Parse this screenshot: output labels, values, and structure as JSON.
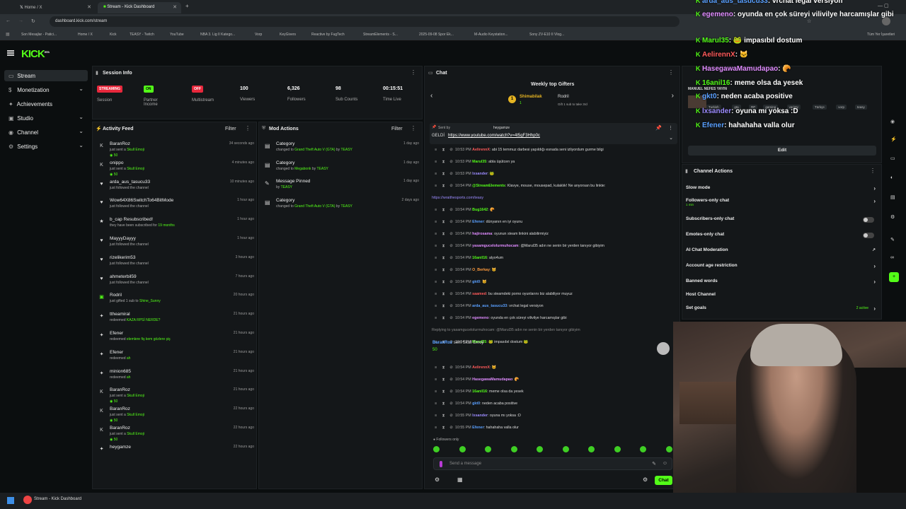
{
  "browser": {
    "tabs": [
      {
        "label": "Home / X"
      },
      {
        "label": "Stream - Kick Dashboard"
      }
    ],
    "url": "dashboard.kick.com/stream",
    "bookmarks": [
      "Son Mesajlar - Patici...",
      "Home / X",
      "Kick",
      "TEASY - Twitch",
      "YouTube",
      "NBA 3. Lig II Katego...",
      "Vorp",
      "KeyGivers",
      "Reactive by FugTech",
      "StreamElements - S...",
      "2025-09-08 Spor Ek...",
      "M-Audio Keystation...",
      "Sony ZV-E10 II Vlog..."
    ],
    "other_bookmarks": "Tüm Yer İşaretleri"
  },
  "header": {
    "logo": "KICK",
    "logo_sup": "BETA"
  },
  "sidebar": {
    "items": [
      {
        "label": "Stream",
        "icon": "▭"
      },
      {
        "label": "Monetization",
        "icon": "$"
      },
      {
        "label": "Achievements",
        "icon": "✦"
      },
      {
        "label": "Studio",
        "icon": "▣"
      },
      {
        "label": "Channel",
        "icon": "◉"
      },
      {
        "label": "Settings",
        "icon": "⚙"
      }
    ]
  },
  "session": {
    "title": "Session Info",
    "stats": [
      {
        "value": "STREAMING",
        "label": "Session",
        "badge_color": "#e8283c"
      },
      {
        "value": "ON",
        "label": "Partner Income",
        "badge_color": "#53fc18"
      },
      {
        "value": "OFF",
        "label": "Multistream",
        "badge_color": "#e8283c"
      },
      {
        "value": "100",
        "label": "Viewers"
      },
      {
        "value": "6,326",
        "label": "Followers"
      },
      {
        "value": "98",
        "label": "Sub Counts"
      },
      {
        "value": "00:15:51",
        "label": "Time Live"
      }
    ]
  },
  "activity_feed": {
    "title": "Activity Feed",
    "filter": "Filter",
    "items": [
      {
        "user": "BaranRoz",
        "desc": "just sent a",
        "hl": "Skull Emoji",
        "time": "34 seconds ago",
        "kicks": "50",
        "icon": "kick"
      },
      {
        "user": "onippo",
        "desc": "just sent a",
        "hl": "Skull Emoji",
        "time": "4 minutes ago",
        "kicks": "50",
        "icon": "kick"
      },
      {
        "user": "arda_aus_tasucu33",
        "desc": "just followed the channel",
        "hl": "",
        "time": "10 minutes ago",
        "kicks": "",
        "icon": "heart"
      },
      {
        "user": "Wow64X86SwitchTo64BitMode",
        "desc": "just followed the channel",
        "hl": "",
        "time": "1 hour ago",
        "kicks": "",
        "icon": "heart"
      },
      {
        "user": "b_cap Resubscribed!",
        "desc": "they have been subscribed for",
        "hl": "19 months",
        "time": "1 hour ago",
        "kicks": "",
        "icon": "star"
      },
      {
        "user": "MayyyDayyy",
        "desc": "just followed the channel",
        "hl": "",
        "time": "1 hour ago",
        "kicks": "",
        "icon": "heart"
      },
      {
        "user": "rizelikerim53",
        "desc": "just followed the channel",
        "hl": "",
        "time": "3 hours ago",
        "kicks": "",
        "icon": "heart"
      },
      {
        "user": "ahmeterbil59",
        "desc": "just followed the channel",
        "hl": "",
        "time": "7 hours ago",
        "kicks": "",
        "icon": "heart"
      },
      {
        "user": "Rodril",
        "desc": "just gifted 1 sub to",
        "hl": "Shine_Sunny",
        "time": "20 hours ago",
        "kicks": "",
        "icon": "gift"
      },
      {
        "user": "ttheamiral",
        "desc": "redeemed",
        "hl": "KAZA RPSİ NERDE?",
        "time": "21 hours ago",
        "kicks": "",
        "icon": "redeem"
      },
      {
        "user": "Efener",
        "desc": "redeemed",
        "hl": "elemlere fiş kem gözlere şiş",
        "time": "21 hours ago",
        "kicks": "",
        "icon": "redeem"
      },
      {
        "user": "Efener",
        "desc": "redeemed",
        "hl": "ah",
        "time": "21 hours ago",
        "kicks": "",
        "icon": "redeem"
      },
      {
        "user": "minion685",
        "desc": "redeemed",
        "hl": "ah",
        "time": "21 hours ago",
        "kicks": "",
        "icon": "redeem"
      },
      {
        "user": "BaranRoz",
        "desc": "just sent a",
        "hl": "Skull Emoji",
        "time": "21 hours ago",
        "kicks": "50",
        "icon": "kick"
      },
      {
        "user": "BaranRoz",
        "desc": "just sent a",
        "hl": "Skull Emoji",
        "time": "22 hours ago",
        "kicks": "50",
        "icon": "kick"
      },
      {
        "user": "BaranRoz",
        "desc": "just sent a",
        "hl": "Skull Emoji",
        "time": "22 hours ago",
        "kicks": "50",
        "icon": "kick"
      },
      {
        "user": "heygamze",
        "desc": "",
        "hl": "",
        "time": "22 hours ago",
        "kicks": "",
        "icon": "redeem"
      }
    ]
  },
  "mod_actions": {
    "title": "Mod Actions",
    "filter": "Filter",
    "items": [
      {
        "title": "Category",
        "desc": "changed to",
        "hl": "Grand Theft Auto V (GTA)",
        "by": "by",
        "mod": "TEASY",
        "time": "1 day ago",
        "icon": "▤"
      },
      {
        "title": "Category",
        "desc": "changed to",
        "hl": "Megabonk",
        "by": "by",
        "mod": "TEASY",
        "time": "1 day ago",
        "icon": "▤"
      },
      {
        "title": "Message Pinned",
        "desc": "",
        "hl": "",
        "by": "by",
        "mod": "TEASY",
        "time": "1 day ago",
        "icon": "✎"
      },
      {
        "title": "Category",
        "desc": "changed to",
        "hl": "Grand Theft Auto V (GTA)",
        "by": "by",
        "mod": "TEASY",
        "time": "2 days ago",
        "icon": "▤"
      }
    ]
  },
  "chat": {
    "title": "Chat",
    "gifters_title": "Weekly top Gifters",
    "gifter1": "Shimabilak",
    "gifter1_count": "1",
    "gifter2": "Rodril",
    "gifter2_note": "Gift 1 sub to take 3rd",
    "pinned_sender": "Sent by",
    "pinned_user": "heygamze",
    "pinned_text": "GELDİ",
    "pinned_link": "https://www.youtube.com/watch?v=4t5gF3Hhp0c",
    "messages": [
      {
        "time": "10:53 PM",
        "user": "AelirennX",
        "color": "#ff5a5a",
        "text": ": abi 15 temmuz darbesi yapıldığı esnada seni izliyordum gurme bilgi"
      },
      {
        "time": "10:53 PM",
        "user": "Marul35",
        "color": "#53fc18",
        "text": ": abla üşütcen ya"
      },
      {
        "time": "10:53 PM",
        "user": "lxsander",
        "color": "#9d8cff",
        "text": ": 🐸"
      },
      {
        "time": "10:54 PM",
        "user": "@StreamElements",
        "color": "#53fc18",
        "text": ": Klavye, mouse, mousepad, kulaklık! Ne anyorsan bu linkte:"
      },
      {
        "time": "",
        "user": "",
        "color": "#9d8cff",
        "text": "https://wraithesports.com/teasy"
      },
      {
        "time": "10:54 PM",
        "user": "Bug1642",
        "color": "#53fc18",
        "text": ": 🥐"
      },
      {
        "time": "10:54 PM",
        "user": "Efener",
        "color": "#5aa0ff",
        "text": ": dünyanın en iyi oyunu"
      },
      {
        "time": "10:54 PM",
        "user": "hajirosama",
        "color": "#e08cff",
        "text": ": oyunun steam linkini alabilirmiyiz"
      },
      {
        "time": "10:54 PM",
        "user": "yasamgucelolurmuhocam",
        "color": "#e08cff",
        "text": ": @Marul35 adın ne senin bir yerden tanıyor gibiyim"
      },
      {
        "time": "10:54 PM",
        "user": "16anil16",
        "color": "#53fc18",
        "text": ": alyo4um"
      },
      {
        "time": "10:54 PM",
        "user": "O_Berkay",
        "color": "#ff9b3d",
        "text": ": 🐱"
      },
      {
        "time": "10:54 PM",
        "user": "gkt0",
        "color": "#5aa0ff",
        "text": ": 🐱"
      },
      {
        "time": "10:54 PM",
        "user": "saamed",
        "color": "#ff5a5a",
        "text": ": bu steamdeki porno oyunlarını biz alabiliyor muyuz"
      },
      {
        "time": "10:54 PM",
        "user": "arda_aus_tasucu33",
        "color": "#5aa0ff",
        "text": ": vrchat legal versiyon"
      },
      {
        "time": "10:54 PM",
        "user": "egemeno",
        "color": "#e08cff",
        "text": ": oyunda en çok süreyi vilivilye harcamışlar gibi"
      },
      {
        "time": "",
        "user": "",
        "color": "#888",
        "text": "Replying to yasamgucelolurmuhocam: @Marul35 adın ne senin bir yerden tanıyor gibiyim"
      },
      {
        "time": "10:54 PM",
        "user": "Marul35",
        "color": "#53fc18",
        "text": ": 🐸 impasıbıl dostum 🐸"
      }
    ],
    "gift_user": "BaranRoz",
    "gift_text": "sent Skull Emoji",
    "gift_kicks": "50",
    "messages2": [
      {
        "time": "10:54 PM",
        "user": "AelirennX",
        "color": "#ff5a5a",
        "text": ": 🐱"
      },
      {
        "time": "10:54 PM",
        "user": "HasegawaMamudapao",
        "color": "#e08cff",
        "text": ": 🥐"
      },
      {
        "time": "10:54 PM",
        "user": "16anil16",
        "color": "#53fc18",
        "text": ": meme olsa da yesek"
      },
      {
        "time": "10:54 PM",
        "user": "gkt0",
        "color": "#5aa0ff",
        "text": ": neden acaba positive"
      },
      {
        "time": "10:55 PM",
        "user": "lxsander",
        "color": "#9d8cff",
        "text": ": oyuna mı yoksa :D"
      },
      {
        "time": "10:55 PM",
        "user": "Efener",
        "color": "#5aa0ff",
        "text": ": hahahaha valla olur"
      }
    ],
    "followers_only": "Followers only",
    "input_placeholder": "Send a message",
    "send_label": "Chat"
  },
  "overlay_chat": [
    {
      "user": "arda_aus_tasucu33",
      "text": ": vrchat legal versiyon",
      "color": "#5aa0ff"
    },
    {
      "user": "egemeno",
      "text": ": oyunda en çok süreyi vilivilye harcamışlar gibi",
      "color": "#e08cff"
    },
    {
      "user": "Marul35",
      "text": ": 🐸 impasıbıl dostum",
      "color": "#53fc18"
    },
    {
      "user": "AelirennX",
      "text": ": 🐱",
      "color": "#ff5a5a"
    },
    {
      "user": "HasegawaMamudapao",
      "text": ": 🥐",
      "color": "#e08cff"
    },
    {
      "user": "16anil16",
      "text": ": meme olsa da yesek",
      "color": "#53fc18"
    },
    {
      "user": "gkt0",
      "text": ": neden acaba positive",
      "color": "#5aa0ff"
    },
    {
      "user": "lxsander",
      "text": ": oyuna mı yoksa :D",
      "color": "#9d8cff"
    },
    {
      "user": "Efener",
      "text": ": hahahaha valla olur",
      "color": "#5aa0ff"
    }
  ],
  "stream_info": {
    "title": "MANUEL NEFES YAYIN",
    "tags": [
      "Turkish",
      "gta",
      "RP",
      "gaming",
      "variety",
      "Türkçe",
      "vorp",
      "teasy"
    ],
    "edit_label": "Edit"
  },
  "channel_actions": {
    "title": "Channel Actions",
    "rows": [
      {
        "label": "Slow mode",
        "sub": "",
        "control": "chevron"
      },
      {
        "label": "Followers-only chat",
        "sub": "1 min",
        "control": "chevron"
      },
      {
        "label": "Subscribers-only chat",
        "sub": "",
        "control": "toggle"
      },
      {
        "label": "Emotes-only chat",
        "sub": "",
        "control": "toggle"
      },
      {
        "label": "AI Chat Moderation",
        "sub": "",
        "control": "external"
      },
      {
        "label": "Account age restriction",
        "sub": "",
        "control": "chevron"
      },
      {
        "label": "Banned words",
        "sub": "",
        "control": "chevron"
      },
      {
        "label": "Host Channel",
        "sub": "",
        "control": "none"
      },
      {
        "label": "Set goals",
        "sub": "",
        "control": "chevron",
        "badge": "2 active"
      }
    ]
  },
  "taskbar": {
    "app_label": "Stream - Kick Dashboard"
  },
  "colors": {
    "accent": "#53fc18",
    "danger": "#e8283c",
    "panel": "#141719",
    "bg": "#0b0e0f"
  }
}
